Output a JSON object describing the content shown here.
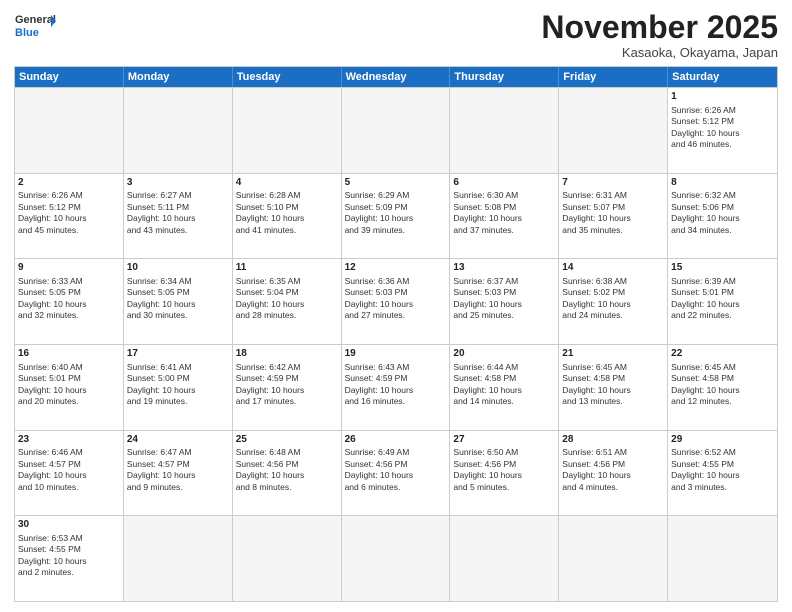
{
  "header": {
    "logo_general": "General",
    "logo_blue": "Blue",
    "month_title": "November 2025",
    "location": "Kasaoka, Okayama, Japan"
  },
  "weekdays": [
    "Sunday",
    "Monday",
    "Tuesday",
    "Wednesday",
    "Thursday",
    "Friday",
    "Saturday"
  ],
  "weeks": [
    [
      {
        "day": "",
        "text": "",
        "empty": true
      },
      {
        "day": "",
        "text": "",
        "empty": true
      },
      {
        "day": "",
        "text": "",
        "empty": true
      },
      {
        "day": "",
        "text": "",
        "empty": true
      },
      {
        "day": "",
        "text": "",
        "empty": true
      },
      {
        "day": "",
        "text": "",
        "empty": true
      },
      {
        "day": "1",
        "text": "Sunrise: 6:26 AM\nSunset: 5:12 PM\nDaylight: 10 hours\nand 46 minutes.",
        "empty": false
      }
    ],
    [
      {
        "day": "2",
        "text": "Sunrise: 6:26 AM\nSunset: 5:12 PM\nDaylight: 10 hours\nand 45 minutes.",
        "empty": false
      },
      {
        "day": "3",
        "text": "Sunrise: 6:27 AM\nSunset: 5:11 PM\nDaylight: 10 hours\nand 43 minutes.",
        "empty": false
      },
      {
        "day": "4",
        "text": "Sunrise: 6:28 AM\nSunset: 5:10 PM\nDaylight: 10 hours\nand 41 minutes.",
        "empty": false
      },
      {
        "day": "5",
        "text": "Sunrise: 6:29 AM\nSunset: 5:09 PM\nDaylight: 10 hours\nand 39 minutes.",
        "empty": false
      },
      {
        "day": "6",
        "text": "Sunrise: 6:30 AM\nSunset: 5:08 PM\nDaylight: 10 hours\nand 37 minutes.",
        "empty": false
      },
      {
        "day": "7",
        "text": "Sunrise: 6:31 AM\nSunset: 5:07 PM\nDaylight: 10 hours\nand 35 minutes.",
        "empty": false
      },
      {
        "day": "8",
        "text": "Sunrise: 6:32 AM\nSunset: 5:06 PM\nDaylight: 10 hours\nand 34 minutes.",
        "empty": false
      }
    ],
    [
      {
        "day": "9",
        "text": "Sunrise: 6:33 AM\nSunset: 5:05 PM\nDaylight: 10 hours\nand 32 minutes.",
        "empty": false
      },
      {
        "day": "10",
        "text": "Sunrise: 6:34 AM\nSunset: 5:05 PM\nDaylight: 10 hours\nand 30 minutes.",
        "empty": false
      },
      {
        "day": "11",
        "text": "Sunrise: 6:35 AM\nSunset: 5:04 PM\nDaylight: 10 hours\nand 28 minutes.",
        "empty": false
      },
      {
        "day": "12",
        "text": "Sunrise: 6:36 AM\nSunset: 5:03 PM\nDaylight: 10 hours\nand 27 minutes.",
        "empty": false
      },
      {
        "day": "13",
        "text": "Sunrise: 6:37 AM\nSunset: 5:03 PM\nDaylight: 10 hours\nand 25 minutes.",
        "empty": false
      },
      {
        "day": "14",
        "text": "Sunrise: 6:38 AM\nSunset: 5:02 PM\nDaylight: 10 hours\nand 24 minutes.",
        "empty": false
      },
      {
        "day": "15",
        "text": "Sunrise: 6:39 AM\nSunset: 5:01 PM\nDaylight: 10 hours\nand 22 minutes.",
        "empty": false
      }
    ],
    [
      {
        "day": "16",
        "text": "Sunrise: 6:40 AM\nSunset: 5:01 PM\nDaylight: 10 hours\nand 20 minutes.",
        "empty": false
      },
      {
        "day": "17",
        "text": "Sunrise: 6:41 AM\nSunset: 5:00 PM\nDaylight: 10 hours\nand 19 minutes.",
        "empty": false
      },
      {
        "day": "18",
        "text": "Sunrise: 6:42 AM\nSunset: 4:59 PM\nDaylight: 10 hours\nand 17 minutes.",
        "empty": false
      },
      {
        "day": "19",
        "text": "Sunrise: 6:43 AM\nSunset: 4:59 PM\nDaylight: 10 hours\nand 16 minutes.",
        "empty": false
      },
      {
        "day": "20",
        "text": "Sunrise: 6:44 AM\nSunset: 4:58 PM\nDaylight: 10 hours\nand 14 minutes.",
        "empty": false
      },
      {
        "day": "21",
        "text": "Sunrise: 6:45 AM\nSunset: 4:58 PM\nDaylight: 10 hours\nand 13 minutes.",
        "empty": false
      },
      {
        "day": "22",
        "text": "Sunrise: 6:45 AM\nSunset: 4:58 PM\nDaylight: 10 hours\nand 12 minutes.",
        "empty": false
      }
    ],
    [
      {
        "day": "23",
        "text": "Sunrise: 6:46 AM\nSunset: 4:57 PM\nDaylight: 10 hours\nand 10 minutes.",
        "empty": false
      },
      {
        "day": "24",
        "text": "Sunrise: 6:47 AM\nSunset: 4:57 PM\nDaylight: 10 hours\nand 9 minutes.",
        "empty": false
      },
      {
        "day": "25",
        "text": "Sunrise: 6:48 AM\nSunset: 4:56 PM\nDaylight: 10 hours\nand 8 minutes.",
        "empty": false
      },
      {
        "day": "26",
        "text": "Sunrise: 6:49 AM\nSunset: 4:56 PM\nDaylight: 10 hours\nand 6 minutes.",
        "empty": false
      },
      {
        "day": "27",
        "text": "Sunrise: 6:50 AM\nSunset: 4:56 PM\nDaylight: 10 hours\nand 5 minutes.",
        "empty": false
      },
      {
        "day": "28",
        "text": "Sunrise: 6:51 AM\nSunset: 4:56 PM\nDaylight: 10 hours\nand 4 minutes.",
        "empty": false
      },
      {
        "day": "29",
        "text": "Sunrise: 6:52 AM\nSunset: 4:55 PM\nDaylight: 10 hours\nand 3 minutes.",
        "empty": false
      }
    ],
    [
      {
        "day": "30",
        "text": "Sunrise: 6:53 AM\nSunset: 4:55 PM\nDaylight: 10 hours\nand 2 minutes.",
        "empty": false
      },
      {
        "day": "",
        "text": "",
        "empty": true
      },
      {
        "day": "",
        "text": "",
        "empty": true
      },
      {
        "day": "",
        "text": "",
        "empty": true
      },
      {
        "day": "",
        "text": "",
        "empty": true
      },
      {
        "day": "",
        "text": "",
        "empty": true
      },
      {
        "day": "",
        "text": "",
        "empty": true
      }
    ]
  ]
}
